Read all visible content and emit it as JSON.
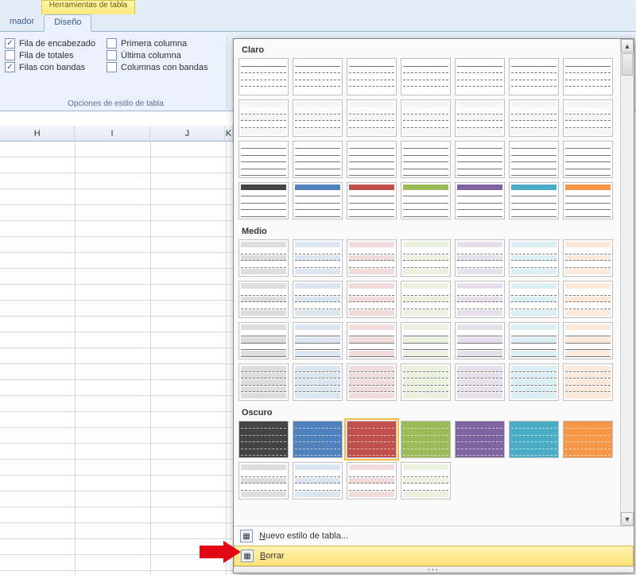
{
  "ribbon": {
    "context_tab_group": "Herramientas de tabla",
    "tabs": {
      "left": "mador",
      "active": "Diseño"
    },
    "options": {
      "header_row": {
        "label": "Fila de encabezado",
        "checked": true
      },
      "total_row": {
        "label": "Fila de totales",
        "checked": false
      },
      "banded_rows": {
        "label": "Filas con bandas",
        "checked": true
      },
      "first_col": {
        "label": "Primera columna",
        "checked": false
      },
      "last_col": {
        "label": "Última columna",
        "checked": false
      },
      "banded_cols": {
        "label": "Columnas con bandas",
        "checked": false
      },
      "group_title": "Opciones de estilo de tabla"
    }
  },
  "sheet": {
    "col_headers": [
      "H",
      "I",
      "J",
      "K"
    ]
  },
  "gallery": {
    "sections": {
      "light": "Claro",
      "medium": "Medio",
      "dark": "Oscuro"
    },
    "palette": [
      "#444444",
      "#4f81bd",
      "#c0504d",
      "#9bbb59",
      "#8064a2",
      "#4bacc6",
      "#f79646"
    ],
    "tint": [
      "#dddddd",
      "#dce6f1",
      "#f2dcdb",
      "#ebf1de",
      "#e5e0ec",
      "#dbeef3",
      "#fde9d9"
    ],
    "menu": {
      "new_style": "Nuevo estilo de tabla...",
      "clear": "Borrar"
    }
  }
}
